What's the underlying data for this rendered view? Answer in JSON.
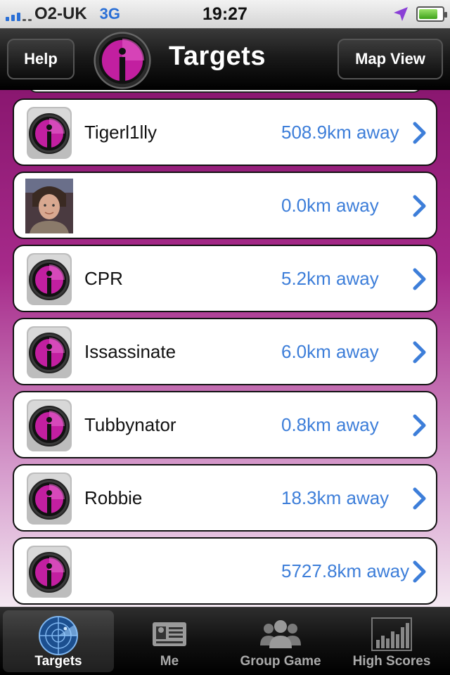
{
  "status_bar": {
    "carrier": "O2-UK",
    "network": "3G",
    "time": "19:27",
    "battery_level": 0.8
  },
  "nav": {
    "help_label": "Help",
    "title": "Targets",
    "map_view_label": "Map View"
  },
  "targets": [
    {
      "name": "Tigerl1lly",
      "distance": "508.9km away",
      "avatar": "target-logo"
    },
    {
      "name": "",
      "distance": "0.0km away",
      "avatar": "photo"
    },
    {
      "name": "CPR",
      "distance": "5.2km away",
      "avatar": "target-logo"
    },
    {
      "name": "Issassinate",
      "distance": "6.0km away",
      "avatar": "target-logo"
    },
    {
      "name": "Tubbynator",
      "distance": "0.8km away",
      "avatar": "target-logo"
    },
    {
      "name": "Robbie",
      "distance": "18.3km away",
      "avatar": "target-logo"
    },
    {
      "name": "",
      "distance": "5727.8km away",
      "avatar": "target-logo"
    }
  ],
  "tab_bar": {
    "tabs": [
      {
        "label": "Targets",
        "icon": "radar-icon",
        "active": true
      },
      {
        "label": "Me",
        "icon": "id-card-icon",
        "active": false
      },
      {
        "label": "Group Game",
        "icon": "group-icon",
        "active": false
      },
      {
        "label": "High Scores",
        "icon": "bar-chart-icon",
        "active": false
      }
    ]
  },
  "colors": {
    "accent_pink": "#c21fa0",
    "distance_blue": "#3d7ed9",
    "status_blue": "#2a6fd6"
  }
}
